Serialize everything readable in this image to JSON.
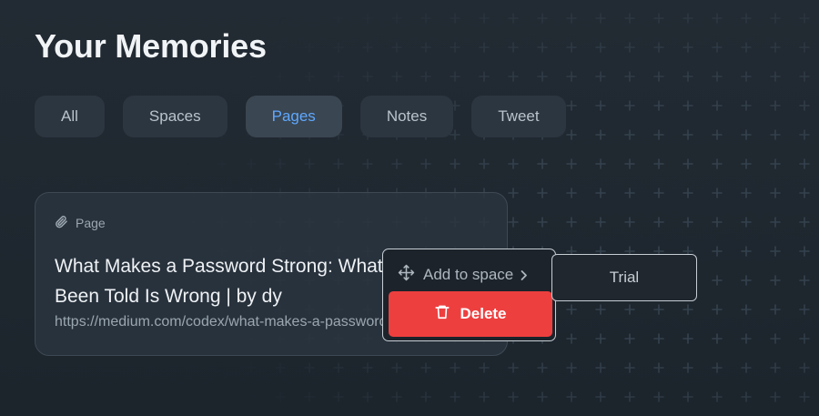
{
  "page": {
    "title": "Your Memories"
  },
  "filters": [
    "All",
    "Spaces",
    "Pages",
    "Notes",
    "Tweet"
  ],
  "active_filter": "Pages",
  "card": {
    "type_icon": "paperclip-icon",
    "type_label": "Page",
    "title": "What Makes a Password Strong: What You’ve Been Told Is Wrong | by dy",
    "url": "https://medium.com/codex/what-makes-a-password-strong"
  },
  "context_menu": {
    "add_icon": "move-icon",
    "add_label": "Add to space",
    "delete_label": "Delete",
    "delete_icon": "trash-icon",
    "delete_color": "#ee3f3f"
  },
  "submenu": {
    "items": [
      "Trial"
    ]
  },
  "colors": {
    "accent": "#5fa8ff",
    "background": "#1f272f"
  }
}
